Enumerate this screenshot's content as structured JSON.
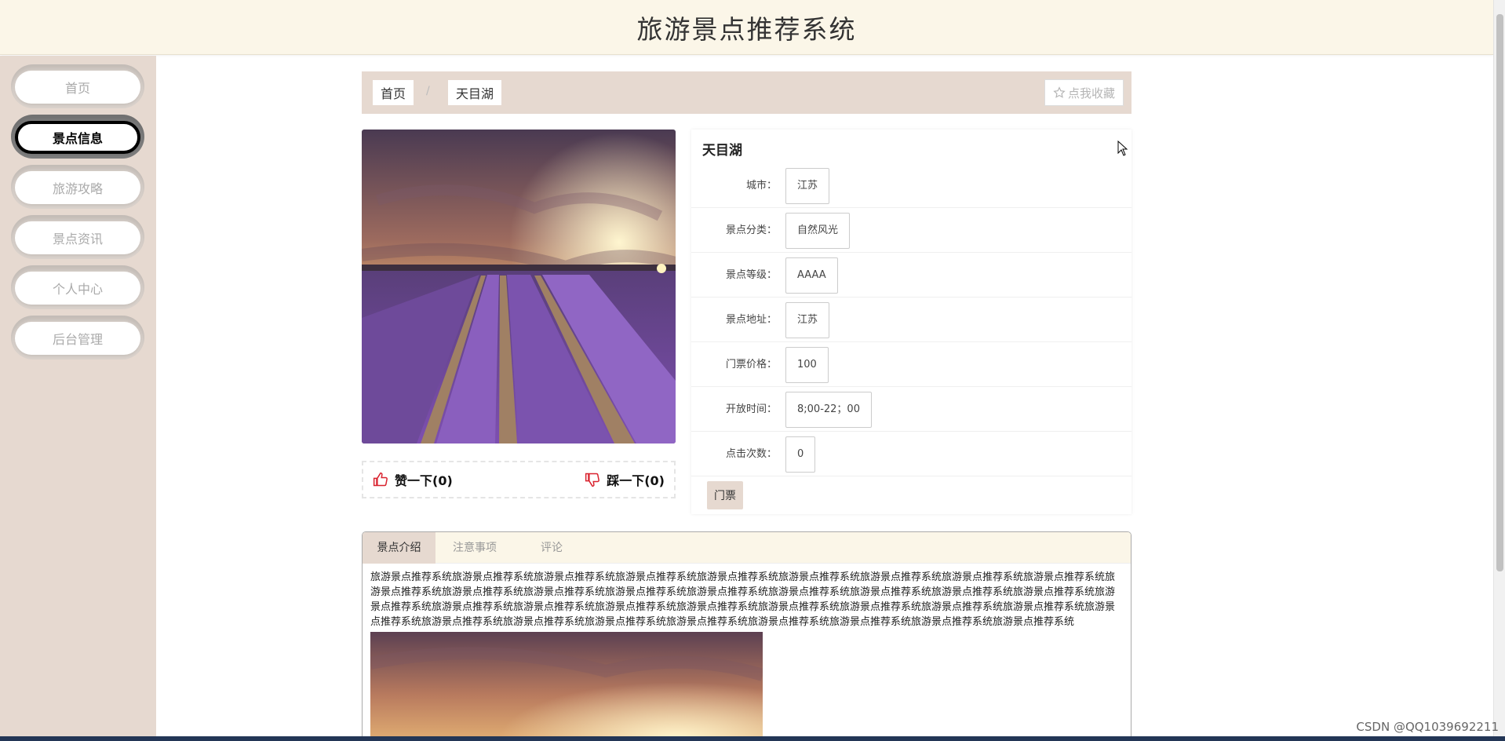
{
  "header": {
    "title": "旅游景点推荐系统"
  },
  "sidebar": {
    "items": [
      {
        "label": "首页"
      },
      {
        "label": "景点信息"
      },
      {
        "label": "旅游攻略"
      },
      {
        "label": "景点资讯"
      },
      {
        "label": "个人中心"
      },
      {
        "label": "后台管理"
      }
    ],
    "active_index": 1
  },
  "breadcrumb": {
    "home": "首页",
    "separator": "/",
    "current": "天目湖"
  },
  "favorite_button": {
    "label": "点我收藏",
    "icon": "star-outline-icon"
  },
  "like_bar": {
    "like_label": "赞一下(0)",
    "dislike_label": "踩一下(0)",
    "like_icon": "thumbs-up-icon",
    "dislike_icon": "thumbs-down-icon"
  },
  "detail": {
    "title": "天目湖",
    "fields": [
      {
        "label": "城市：",
        "value": "江苏"
      },
      {
        "label": "景点分类：",
        "value": "自然风光"
      },
      {
        "label": "景点等级：",
        "value": "AAAA"
      },
      {
        "label": "景点地址：",
        "value": "江苏"
      },
      {
        "label": "门票价格：",
        "value": "100"
      },
      {
        "label": "开放时间：",
        "value": "8;00-22；00"
      },
      {
        "label": "点击次数：",
        "value": "0"
      }
    ],
    "ticket_button": "门票"
  },
  "tabs": {
    "items": [
      {
        "label": "景点介绍"
      },
      {
        "label": "注意事项"
      },
      {
        "label": "评论"
      }
    ],
    "active_index": 0,
    "intro_text": "旅游景点推荐系统旅游景点推荐系统旅游景点推荐系统旅游景点推荐系统旅游景点推荐系统旅游景点推荐系统旅游景点推荐系统旅游景点推荐系统旅游景点推荐系统旅游景点推荐系统旅游景点推荐系统旅游景点推荐系统旅游景点推荐系统旅游景点推荐系统旅游景点推荐系统旅游景点推荐系统旅游景点推荐系统旅游景点推荐系统旅游景点推荐系统旅游景点推荐系统旅游景点推荐系统旅游景点推荐系统旅游景点推荐系统旅游景点推荐系统旅游景点推荐系统旅游景点推荐系统旅游景点推荐系统旅游景点推荐系统旅游景点推荐系统旅游景点推荐系统旅游景点推荐系统旅游景点推荐系统旅游景点推荐系统旅游景点推荐系统旅游景点推荐系统旅游景点推荐系统"
  },
  "watermark": "CSDN @QQ1039692211",
  "colors": {
    "accent": "#e6d9d0",
    "header_bg": "#fbf6e8",
    "thumb_icon": "#d9232f"
  }
}
